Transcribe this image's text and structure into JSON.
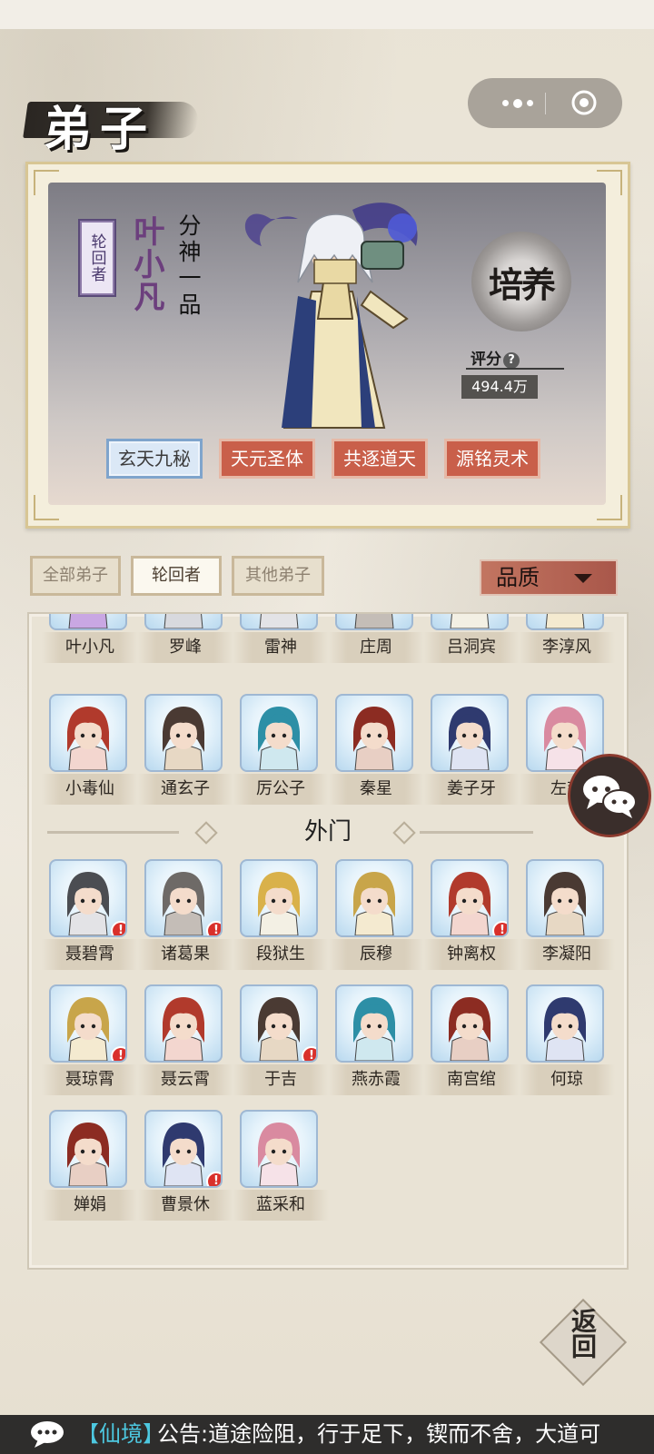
{
  "page_title": "弟子",
  "hero": {
    "role_badge": "轮回者",
    "name": "叶小凡",
    "rank": "分神一品",
    "cultivate_label": "培养",
    "score_label": "评分",
    "score_help": "?",
    "score_value": "494.4万",
    "skills": [
      "玄天九秘",
      "天元圣体",
      "共逐道天",
      "源铭灵术"
    ]
  },
  "filters": {
    "tabs": [
      "全部弟子",
      "轮回者",
      "其他弟子"
    ],
    "active_tab": "轮回者",
    "quality_label": "品质"
  },
  "inner_disciples": {
    "row1": [
      "叶小凡",
      "罗峰",
      "雷神",
      "庄周",
      "吕洞宾",
      "李淳风"
    ],
    "row2": [
      "小毒仙",
      "通玄子",
      "厉公子",
      "秦星",
      "姜子牙",
      "左慈"
    ]
  },
  "outer_section_title": "外门",
  "outer_disciples": {
    "row1": [
      {
        "name": "聂碧霄",
        "alert": true
      },
      {
        "name": "诸葛果",
        "alert": true
      },
      {
        "name": "段狱生",
        "alert": false
      },
      {
        "name": "辰穆",
        "alert": false
      },
      {
        "name": "钟离权",
        "alert": true
      },
      {
        "name": "李凝阳",
        "alert": false
      }
    ],
    "row2": [
      {
        "name": "聂琼霄",
        "alert": true
      },
      {
        "name": "聂云霄",
        "alert": false
      },
      {
        "name": "于吉",
        "alert": true
      },
      {
        "name": "燕赤霞",
        "alert": false
      },
      {
        "name": "南宫绾",
        "alert": false
      },
      {
        "name": "何琼",
        "alert": false
      }
    ],
    "row3": [
      {
        "name": "婵娟",
        "alert": false
      },
      {
        "name": "曹景休",
        "alert": true
      },
      {
        "name": "蓝采和",
        "alert": false
      }
    ]
  },
  "alert_glyph": "!",
  "back_label": "返回",
  "ticker": {
    "tag": "【仙境】",
    "message": "公告:道途险阻，行于足下，锲而不舍，大道可"
  },
  "colors": {
    "skill_red": "#c95f4a",
    "skill_selected": "#dbe8f6",
    "hero_name": "#6c3f7d",
    "ticker_tag": "#4dc8e0",
    "alert": "#d9302b"
  }
}
